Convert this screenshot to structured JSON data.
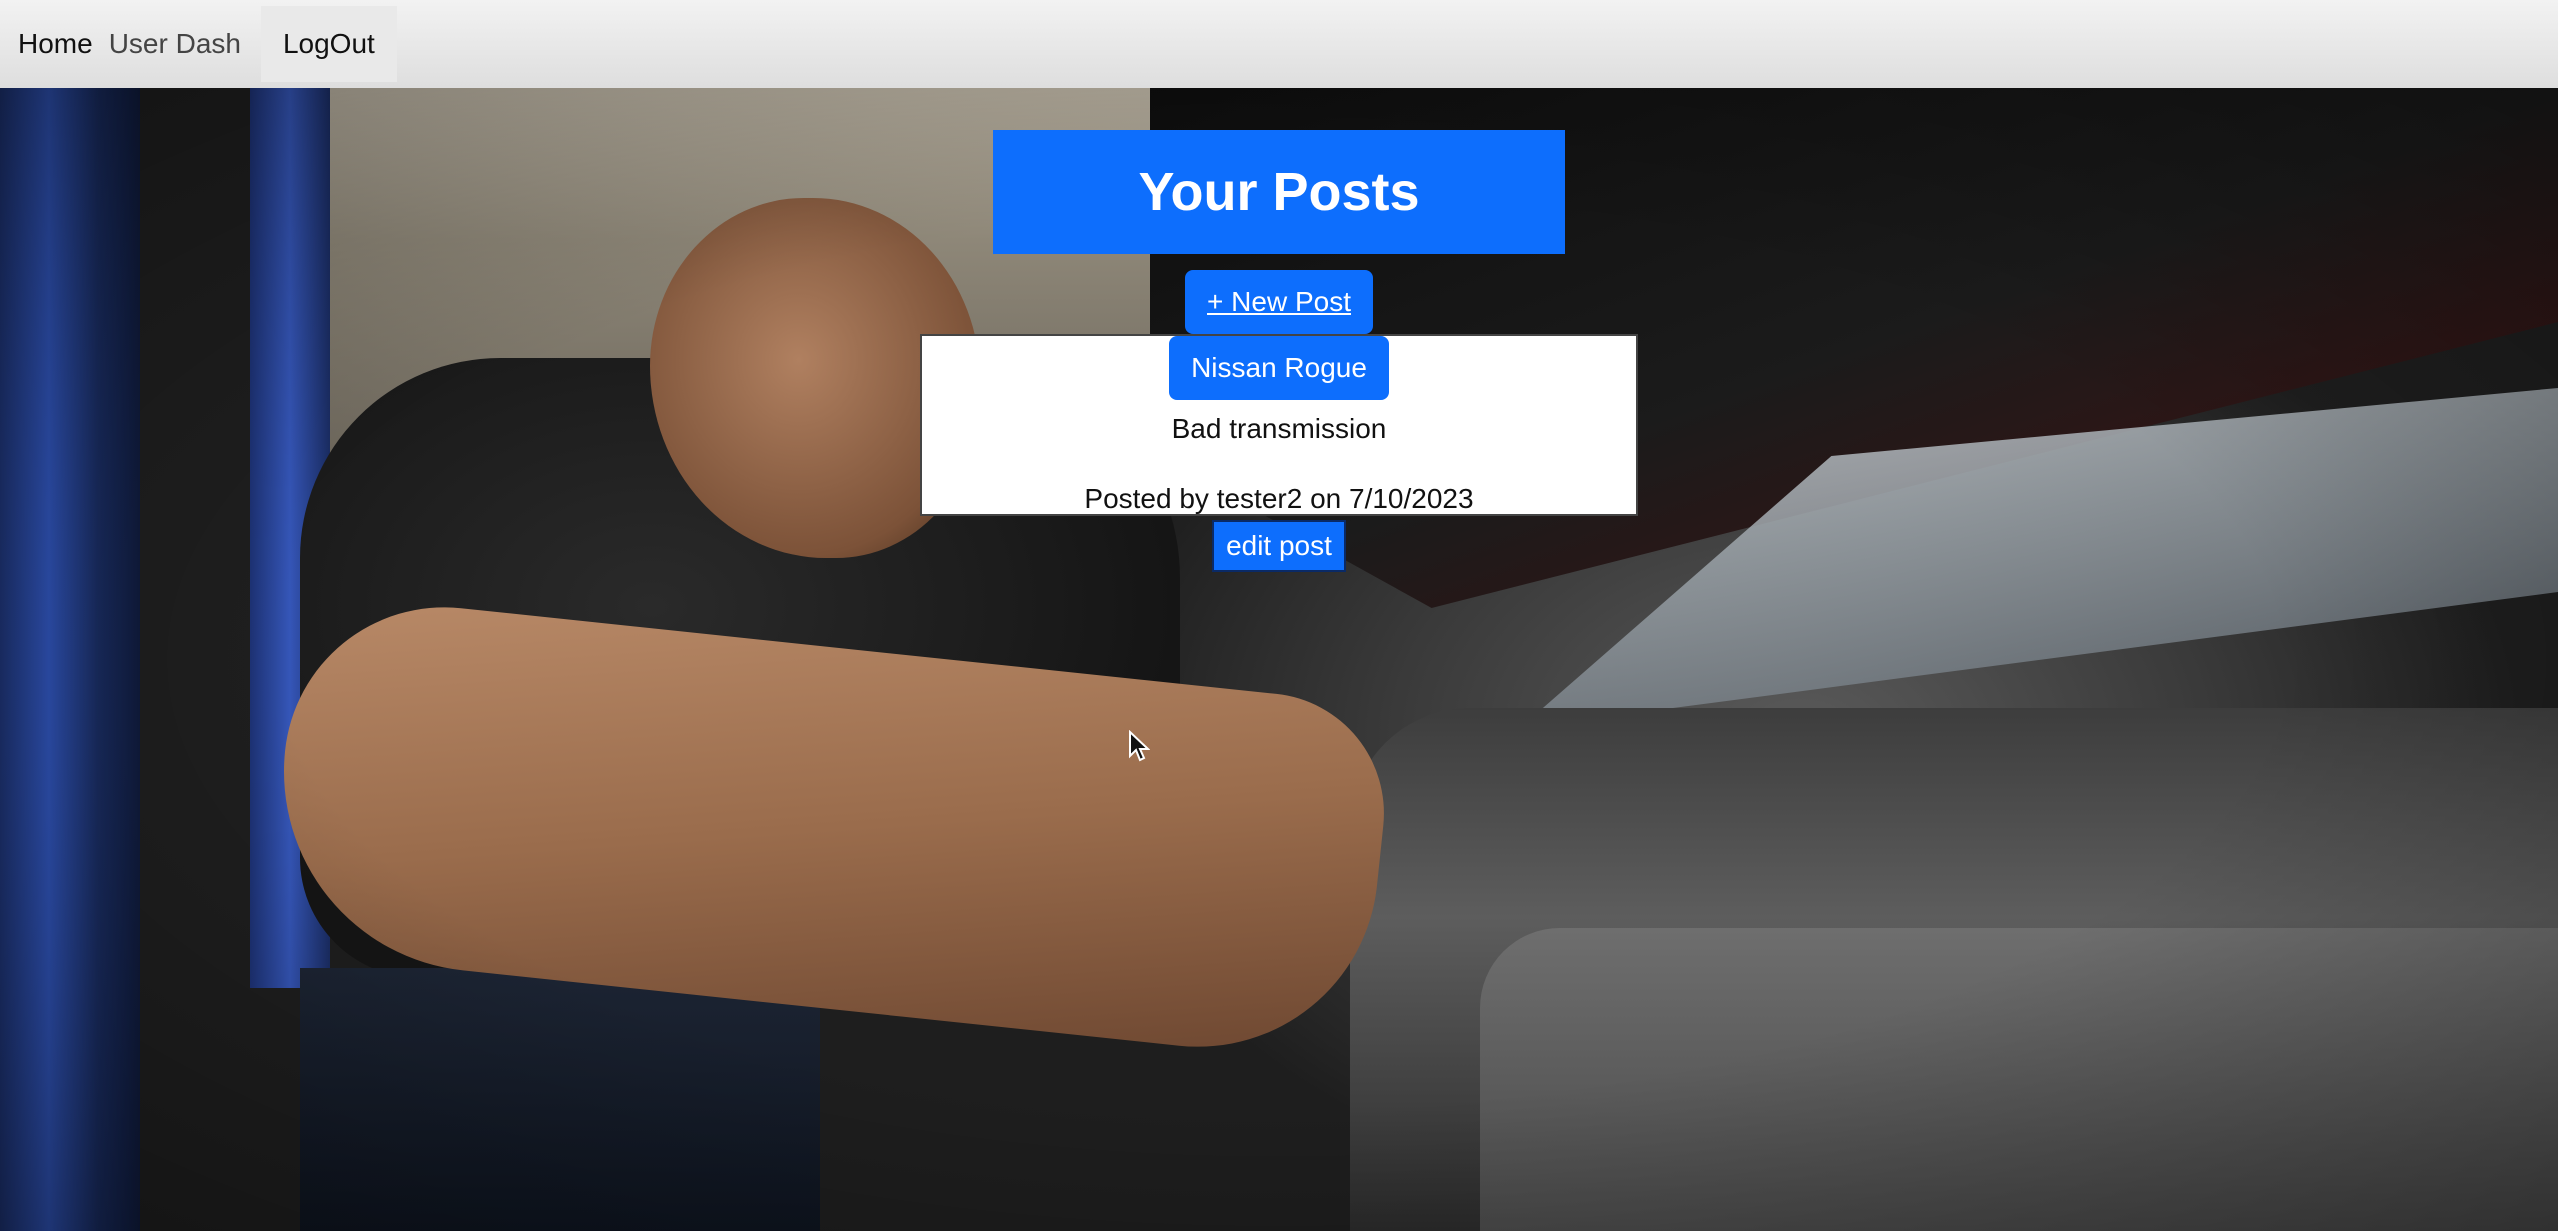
{
  "nav": {
    "home": "Home",
    "user_dash": "User Dash",
    "logout": "LogOut"
  },
  "page": {
    "title": "Your Posts",
    "new_post_label": "+ New Post"
  },
  "posts": [
    {
      "title": "Nissan Rogue",
      "body": "Bad transmission",
      "meta": "Posted by tester2 on 7/10/2023",
      "edit_label": "edit post"
    }
  ]
}
